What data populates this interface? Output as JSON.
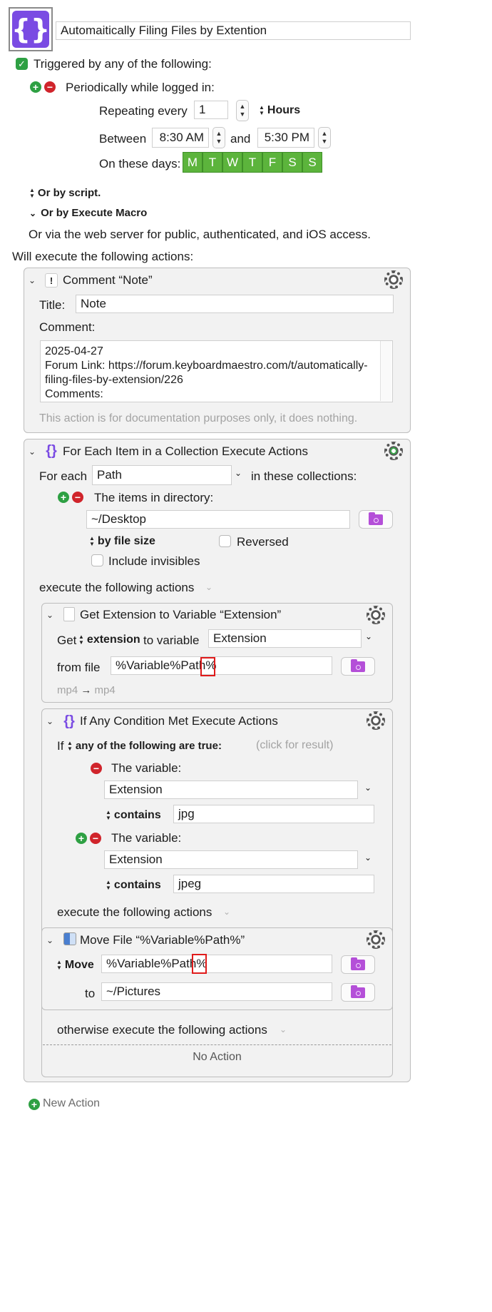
{
  "macro": {
    "title": "Automaitically Filing Files by Extention"
  },
  "trigger": {
    "header": "Triggered by any of the following:",
    "periodic_label": "Periodically while logged in:",
    "repeating_label": "Repeating every",
    "repeat_value": "1",
    "unit": "Hours",
    "between_label": "Between",
    "start_time": "8:30 AM",
    "and_label": "and",
    "end_time": "5:30 PM",
    "days_label": "On these days:",
    "days": [
      "M",
      "T",
      "W",
      "T",
      "F",
      "S",
      "S"
    ],
    "by_script": "Or by script.",
    "by_execute_macro": "Or by Execute Macro",
    "web_server_note": "Or via the web server for public, authenticated, and iOS access."
  },
  "actions_header": "Will execute the following actions:",
  "comment_action": {
    "title": "Comment “Note”",
    "title_label": "Title:",
    "title_value": "Note",
    "comment_label": "Comment:",
    "comment_lines": [
      "2025-04-27",
      "Forum Link: https://forum.keyboardmaestro.com/t/automatically-",
      "filing-files-by-extension/226",
      "Comments:"
    ],
    "note": "This action is for documentation purposes only, it does nothing."
  },
  "foreach_action": {
    "title": "For Each Item in a Collection Execute Actions",
    "for_each_label": "For each",
    "variable": "Path",
    "collections_label": "in these collections:",
    "items_label": "The items in directory:",
    "directory": "~/Desktop",
    "sort": "by file size",
    "reversed_label": "Reversed",
    "invisibles_label": "Include invisibles",
    "execute_label": "execute the following actions"
  },
  "getext_action": {
    "title": "Get Extension to Variable “Extension”",
    "get_label": "Get",
    "kind": "extension",
    "to_variable_label": "to variable",
    "variable": "Extension",
    "from_file_label": "from file",
    "file_value": "%Variable%Path%",
    "preview_from": "mp4",
    "preview_arrow": "→",
    "preview_to": "mp4"
  },
  "if_action": {
    "title": "If Any Condition Met Execute Actions",
    "if_label": "If",
    "condition_mode": "any of the following are true:",
    "click_result": "(click for result)",
    "conditions": [
      {
        "label": "The variable:",
        "variable": "Extension",
        "operator": "contains",
        "value": "jpg"
      },
      {
        "label": "The variable:",
        "variable": "Extension",
        "operator": "contains",
        "value": "jpeg"
      }
    ],
    "execute_label": "execute the following actions",
    "otherwise_label": "otherwise execute the following actions",
    "no_action": "No Action"
  },
  "move_action": {
    "title": "Move File “%Variable%Path%”",
    "move_label": "Move",
    "source": "%Variable%Path%",
    "to_label": "to",
    "destination": "~/Pictures"
  },
  "new_action_label": "New Action",
  "colors": {
    "accent_green": "#5cb43c",
    "folder_purple": "#b44fd8",
    "highlight_red": "#e01b1b",
    "macro_purple": "#7a4be3"
  }
}
